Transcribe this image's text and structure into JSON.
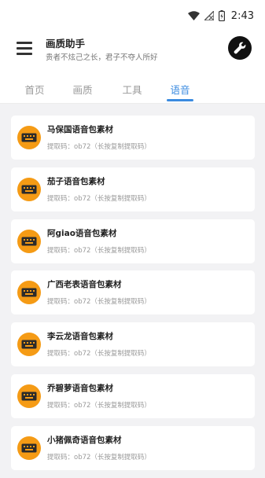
{
  "status_bar": {
    "time": "2:43",
    "icons": [
      "wifi-icon",
      "signal-off-icon",
      "battery-charging-icon"
    ]
  },
  "header": {
    "title": "画质助手",
    "subtitle": "贵者不炫己之长，君子不夺人所好",
    "left_icon": "menu-icon",
    "right_icon": "wrench-icon"
  },
  "tabs": {
    "items": [
      {
        "label": "首页"
      },
      {
        "label": "画质"
      },
      {
        "label": "工具"
      },
      {
        "label": "语音"
      }
    ],
    "active_index": 3
  },
  "colors": {
    "accent": "#3b8be0",
    "icon_orange": "#f59b15",
    "background": "#f2f2f4"
  },
  "items": [
    {
      "title": "马保国语音包素材",
      "code_line": "提取码：ob72（长按复制提取码）"
    },
    {
      "title": "茄子语音包素材",
      "code_line": "提取码：ob72（长按复制提取码）"
    },
    {
      "title": "阿giao语音包素材",
      "code_line": "提取码：ob72（长按复制提取码）"
    },
    {
      "title": "广西老表语音包素材",
      "code_line": "提取码：ob72（长按复制提取码）"
    },
    {
      "title": "李云龙语音包素材",
      "code_line": "提取码：ob72（长按复制提取码）"
    },
    {
      "title": "乔碧萝语音包素材",
      "code_line": "提取码：ob72（长按复制提取码）"
    },
    {
      "title": "小猪佩奇语音包素材",
      "code_line": "提取码：ob72（长按复制提取码）"
    }
  ]
}
